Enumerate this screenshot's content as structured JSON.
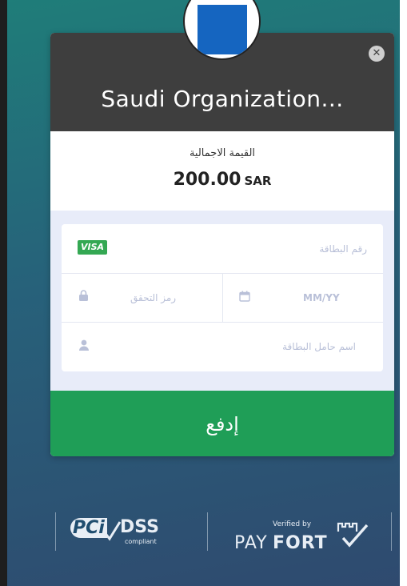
{
  "header": {
    "title": "Saudi Organization...",
    "close_icon": "close-icon"
  },
  "logo": {
    "color": "#1565c0",
    "icon": "organization-logo"
  },
  "amount": {
    "label": "القيمة الاجمالية",
    "value": "200.00",
    "currency": "SAR"
  },
  "form": {
    "card_number_placeholder": "رقم البطاقة",
    "card_brand": "VISA",
    "expiry_placeholder": "MM/YY",
    "cvv_placeholder": "رمز التحقق",
    "holder_name_placeholder": "اسم حامل البطاقة",
    "icons": [
      "calendar-icon",
      "lock-icon",
      "user-icon"
    ]
  },
  "pay_button": {
    "label": "إدفع",
    "color": "#1f9e57"
  },
  "footer": {
    "pci_label": "PCi",
    "dss_label": "DSS",
    "dss_sub": "compliant",
    "verified_by": "Verified by",
    "pay_label": "PAY",
    "fort_label": "FORT"
  },
  "colors": {
    "header_bg": "#3e3e3e",
    "form_bg": "#e8ecf9",
    "visa_badge": "#34a853"
  }
}
